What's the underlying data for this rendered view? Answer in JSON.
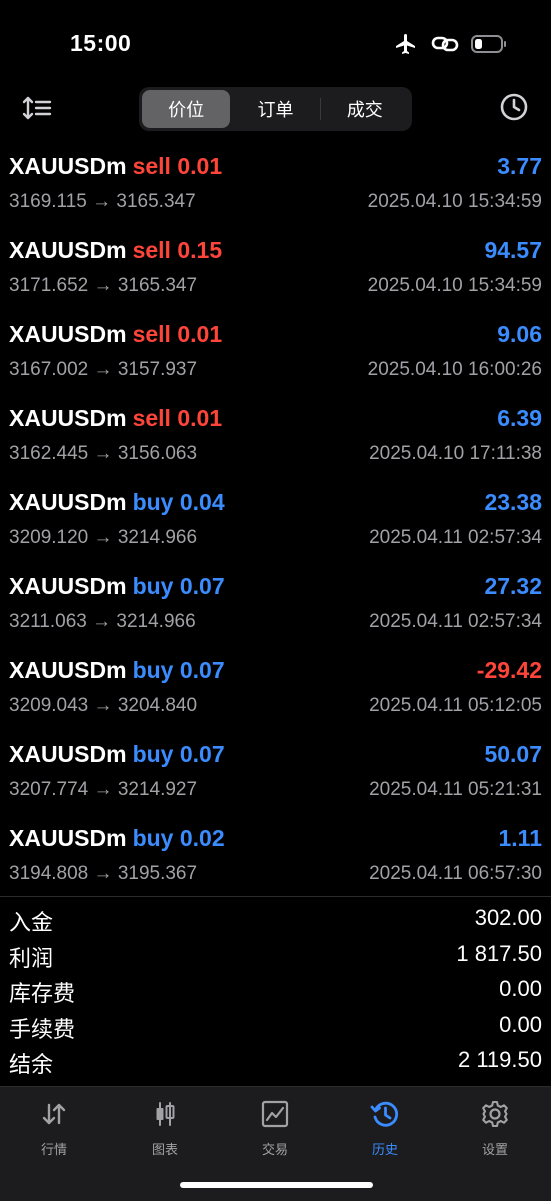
{
  "status_bar": {
    "time": "15:00"
  },
  "segment": {
    "tabs": [
      "价位",
      "订单",
      "成交"
    ],
    "active": 0
  },
  "deals": [
    {
      "symbol": "XAUUSDm",
      "side": "sell",
      "volume": "0.01",
      "profit": "3.77",
      "open": "3169.115",
      "close": "3165.347",
      "datetime": "2025.04.10 15:34:59"
    },
    {
      "symbol": "XAUUSDm",
      "side": "sell",
      "volume": "0.15",
      "profit": "94.57",
      "open": "3171.652",
      "close": "3165.347",
      "datetime": "2025.04.10 15:34:59"
    },
    {
      "symbol": "XAUUSDm",
      "side": "sell",
      "volume": "0.01",
      "profit": "9.06",
      "open": "3167.002",
      "close": "3157.937",
      "datetime": "2025.04.10 16:00:26"
    },
    {
      "symbol": "XAUUSDm",
      "side": "sell",
      "volume": "0.01",
      "profit": "6.39",
      "open": "3162.445",
      "close": "3156.063",
      "datetime": "2025.04.10 17:11:38"
    },
    {
      "symbol": "XAUUSDm",
      "side": "buy",
      "volume": "0.04",
      "profit": "23.38",
      "open": "3209.120",
      "close": "3214.966",
      "datetime": "2025.04.11 02:57:34"
    },
    {
      "symbol": "XAUUSDm",
      "side": "buy",
      "volume": "0.07",
      "profit": "27.32",
      "open": "3211.063",
      "close": "3214.966",
      "datetime": "2025.04.11 02:57:34"
    },
    {
      "symbol": "XAUUSDm",
      "side": "buy",
      "volume": "0.07",
      "profit": "-29.42",
      "open": "3209.043",
      "close": "3204.840",
      "datetime": "2025.04.11 05:12:05"
    },
    {
      "symbol": "XAUUSDm",
      "side": "buy",
      "volume": "0.07",
      "profit": "50.07",
      "open": "3207.774",
      "close": "3214.927",
      "datetime": "2025.04.11 05:21:31"
    },
    {
      "symbol": "XAUUSDm",
      "side": "buy",
      "volume": "0.02",
      "profit": "1.11",
      "open": "3194.808",
      "close": "3195.367",
      "datetime": "2025.04.11 06:57:30"
    }
  ],
  "summary": [
    {
      "label": "入金",
      "value": "302.00"
    },
    {
      "label": "利润",
      "value": "1 817.50"
    },
    {
      "label": "库存费",
      "value": "0.00"
    },
    {
      "label": "手续费",
      "value": "0.00"
    },
    {
      "label": "结余",
      "value": "2 119.50"
    }
  ],
  "tabbar": [
    {
      "label": "行情",
      "icon": "quotes-arrows-icon"
    },
    {
      "label": "图表",
      "icon": "candlestick-chart-icon"
    },
    {
      "label": "交易",
      "icon": "trade-chart-icon"
    },
    {
      "label": "历史",
      "icon": "history-clock-icon",
      "active": true
    },
    {
      "label": "设置",
      "icon": "gear-icon"
    }
  ],
  "colors": {
    "accent": "#3b8cff",
    "sell": "#ff453a",
    "negative": "#ff453a",
    "muted": "#a1a1a6"
  }
}
